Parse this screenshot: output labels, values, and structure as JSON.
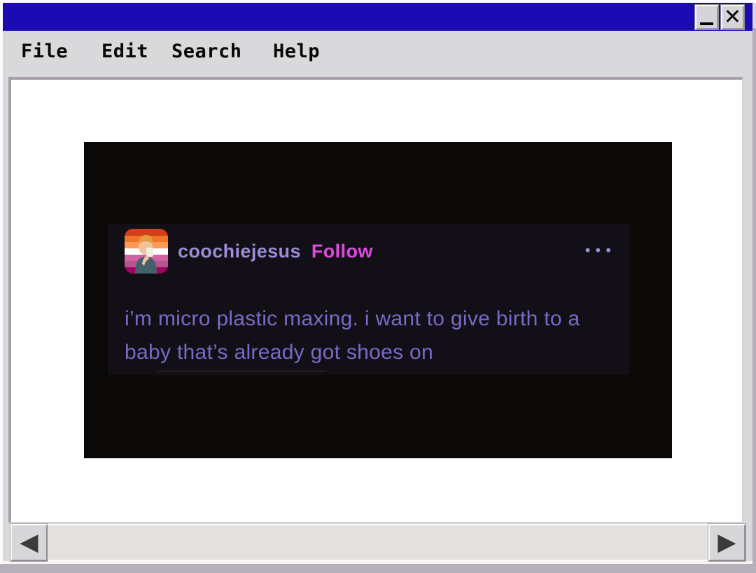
{
  "window": {
    "titlebar_color": "#1c0bb5",
    "controls": {
      "minimize_glyph": "_",
      "close_glyph": "✕"
    }
  },
  "menubar": {
    "items": [
      {
        "label": "File"
      },
      {
        "label": "Edit"
      },
      {
        "label": "Search"
      },
      {
        "label": "Help"
      }
    ]
  },
  "viewer": {
    "post": {
      "username": "coochiejesus",
      "follow_label": "Follow",
      "more_glyph": "•••",
      "body_lines": [
        "i’m micro plastic maxing. i want to give birth to a",
        "baby that’s already got shoes on"
      ],
      "avatar_icon": "bobby-hill-lesbian-flag-avatar",
      "colors": {
        "username": "#9b8cd6",
        "follow": "#de4ae0",
        "body_text": "#7b69c8",
        "card_bg": "#121016",
        "image_bg": "#0a0907"
      }
    }
  },
  "scrollbar": {
    "left_glyph": "◀",
    "right_glyph": "▶"
  }
}
